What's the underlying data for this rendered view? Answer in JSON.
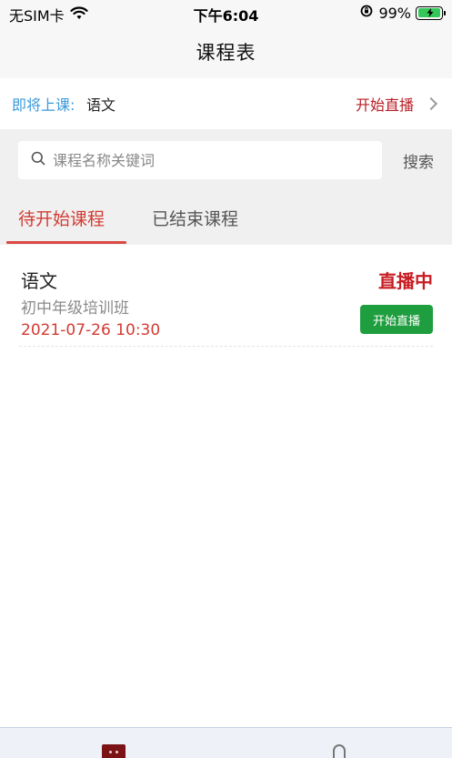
{
  "status_bar": {
    "carrier": "无SIM卡",
    "time": "下午6:04",
    "battery": "99%",
    "battery_level": 0.99
  },
  "nav": {
    "title": "课程表"
  },
  "upcoming": {
    "label": "即将上课:",
    "course": "语文",
    "action": "开始直播"
  },
  "search": {
    "placeholder": "课程名称关键词",
    "button": "搜索"
  },
  "tabs": [
    {
      "label": "待开始课程",
      "active": true
    },
    {
      "label": "已结束课程",
      "active": false
    }
  ],
  "courses": [
    {
      "name": "语文",
      "class": "初中年级培训班",
      "time": "2021-07-26 10:30",
      "status": "直播中",
      "button": "开始直播"
    }
  ],
  "colors": {
    "accent_red": "#d33b33",
    "status_red": "#c81d23",
    "link_blue": "#3a9ad9",
    "button_green": "#1e9e3e"
  }
}
